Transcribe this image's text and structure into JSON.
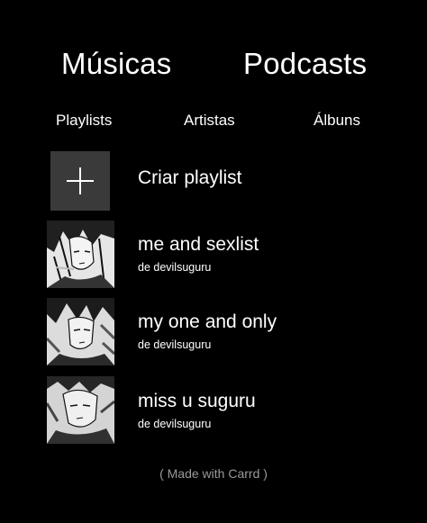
{
  "tabs": {
    "musicas": "Músicas",
    "podcasts": "Podcasts"
  },
  "subtabs": {
    "playlists": "Playlists",
    "artistas": "Artistas",
    "albuns": "Álbuns"
  },
  "create": {
    "label": "Criar playlist",
    "icon": "plus-icon"
  },
  "playlists": [
    {
      "title": "me and sexlist",
      "owner": "de devilsuguru"
    },
    {
      "title": "my one and only",
      "owner": "de devilsuguru"
    },
    {
      "title": "miss u suguru",
      "owner": "de devilsuguru"
    }
  ],
  "footer": "( Made with Carrd )",
  "colors": {
    "background": "#000000",
    "text": "#ffffff",
    "add_box": "#3a3a3a",
    "footer_text": "#9a9a9a"
  }
}
